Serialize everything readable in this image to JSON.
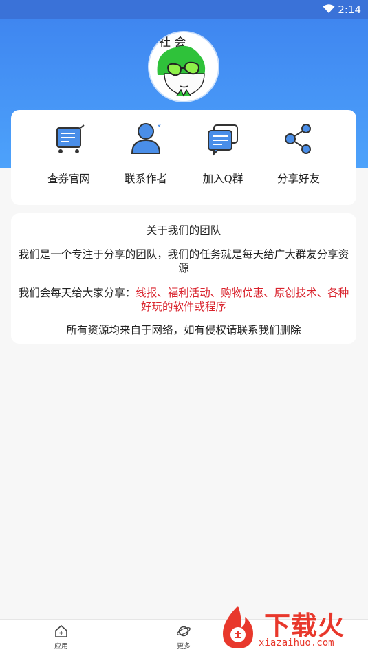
{
  "status_bar": {
    "time": "2:14"
  },
  "avatar": {
    "caption": "社 会"
  },
  "menu": [
    {
      "label": "查券官网",
      "icon": "cart-icon"
    },
    {
      "label": "联系作者",
      "icon": "user-icon"
    },
    {
      "label": "加入Q群",
      "icon": "chat-icon"
    },
    {
      "label": "分享好友",
      "icon": "share-icon"
    }
  ],
  "about": {
    "title": "关于我们的团队",
    "p1": "我们是一个专注于分享的团队，我们的任务就是每天给广大群友分享资源",
    "p2_prefix": "我们会每天给大家分享：",
    "p2_highlight": "线报、福利活动、购物优惠、原创技术、各种好玩的软件或程序",
    "p3": "所有资源均来自于网络，如有侵权请联系我们删除"
  },
  "bottom_nav": [
    {
      "label": "应用",
      "icon": "home-icon"
    },
    {
      "label": "更多",
      "icon": "planet-icon"
    }
  ],
  "watermark": {
    "text": "下载火",
    "url": "xiazaihuo.com"
  },
  "colors": {
    "primary": "#3f86f0",
    "highlight": "#d9232d",
    "watermark": "#e8382c"
  }
}
